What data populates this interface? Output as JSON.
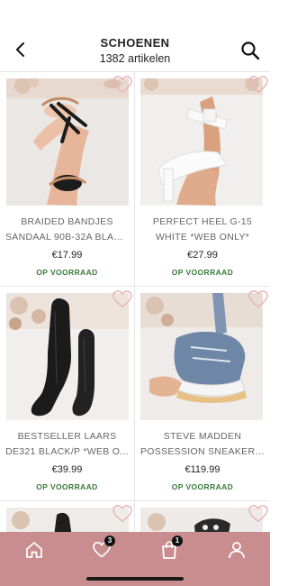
{
  "header": {
    "title": "SCHOENEN",
    "subtitle": "1382 artikelen",
    "back_icon": "chevron-left-icon",
    "search_icon": "search-icon"
  },
  "products": [
    {
      "name_line1": "BRAIDED BANDJES",
      "name_line2": "SANDAAL 90B-32A BLAC...",
      "price": "€17.99",
      "stock": "OP VOORRAAD"
    },
    {
      "name_line1": "PERFECT HEEL G-15",
      "name_line2": "WHITE *WEB ONLY*",
      "price": "€27.99",
      "stock": "OP VOORRAAD"
    },
    {
      "name_line1": "BESTSELLER LAARS",
      "name_line2": "DE321 BLACK/P *WEB O...",
      "price": "€39.99",
      "stock": "OP VOORRAAD"
    },
    {
      "name_line1": "STEVE MADDEN",
      "name_line2": "POSSESSION SNEAKER 0...",
      "price": "€119.99",
      "stock": "OP VOORRAAD"
    }
  ],
  "tabbar": {
    "wishlist_badge": "3",
    "cart_badge": "1",
    "icons": [
      "home-icon",
      "heart-icon",
      "shopping-bag-icon",
      "user-icon"
    ]
  },
  "colors": {
    "tabbar": "#c98d8f",
    "stock_green": "#3a7a3a",
    "heart_outline": "#e8b4b4"
  }
}
